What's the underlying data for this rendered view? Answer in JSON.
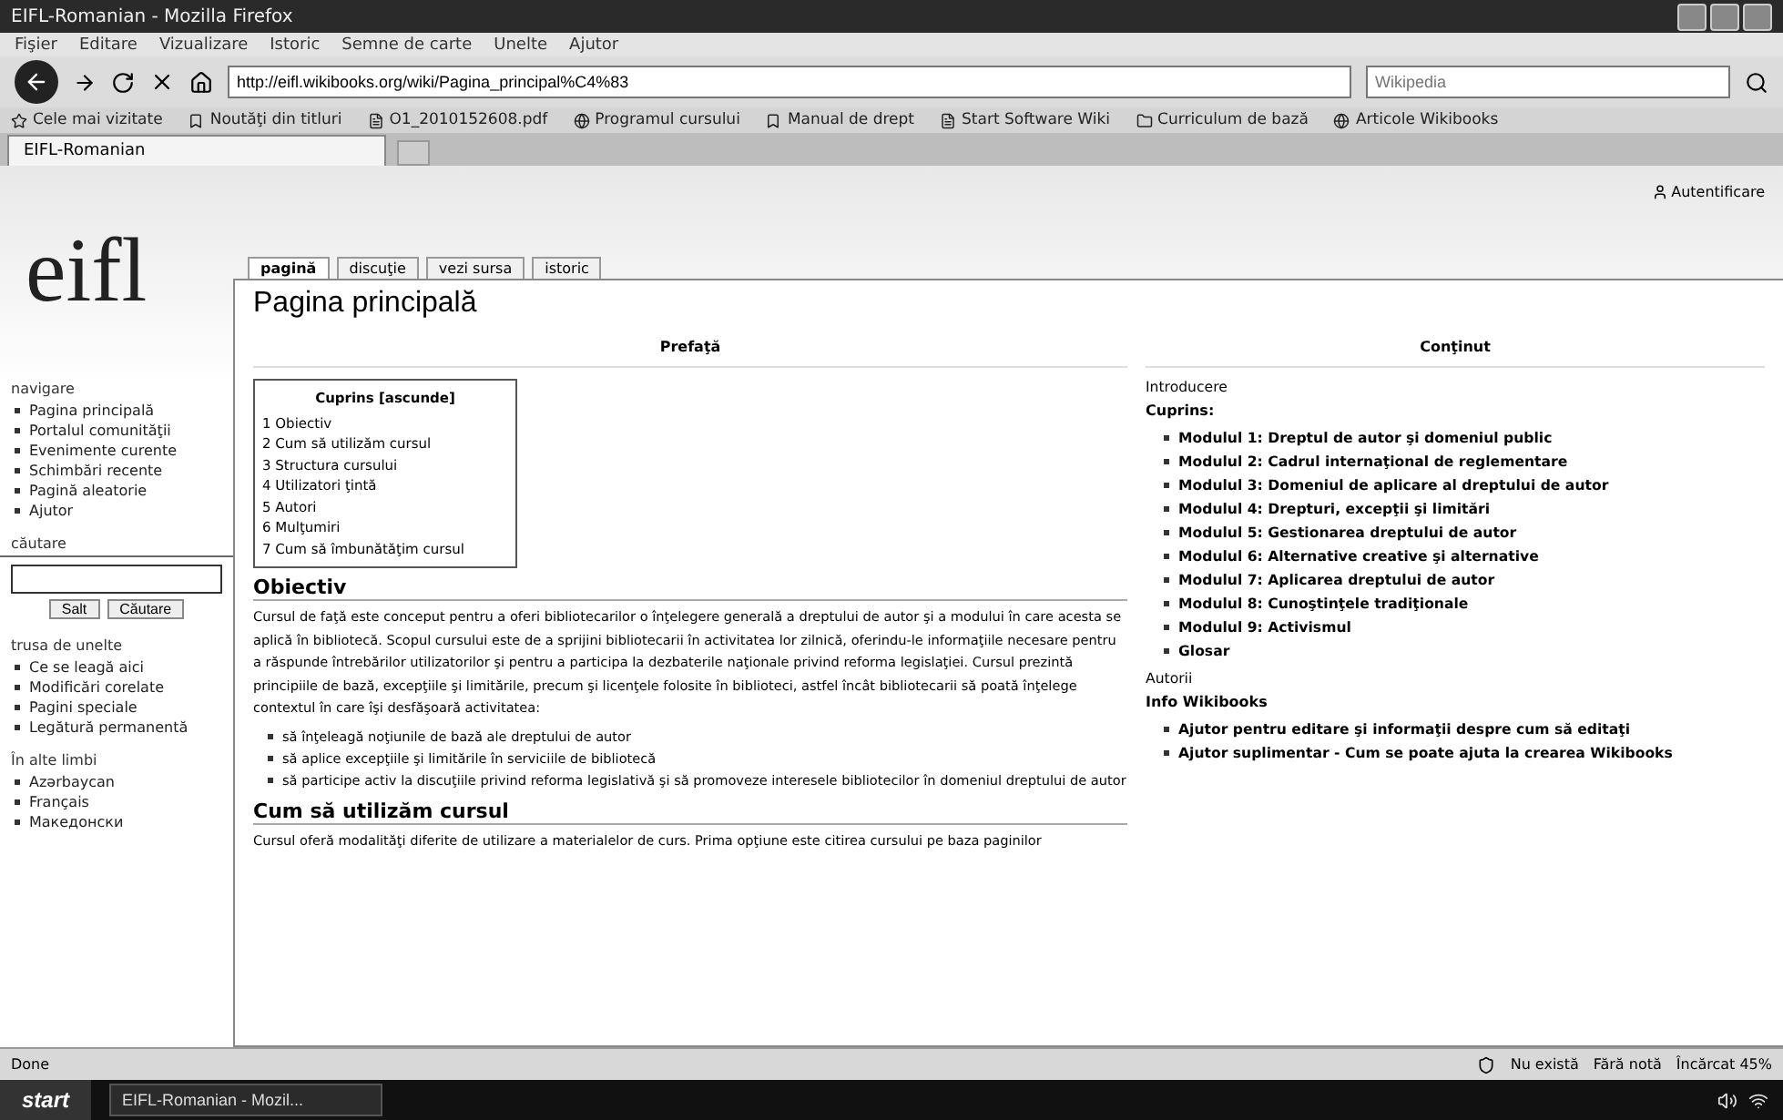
{
  "window": {
    "title": "EIFL-Romanian - Mozilla Firefox"
  },
  "menu": [
    "Fişier",
    "Editare",
    "Vizualizare",
    "Istoric",
    "Semne de carte",
    "Unelte",
    "Ajutor"
  ],
  "address": {
    "value": "http://eifl.wikibooks.org/wiki/Pagina_principal%C4%83"
  },
  "search": {
    "placeholder": "Wikipedia"
  },
  "bookmarks": [
    "Cele mai vizitate",
    "Noutăţi din titluri",
    "O1_2010152608.pdf",
    "Programul cursului",
    "Manual de drept",
    "Start Software Wiki",
    "Curriculum de bază",
    "Articole Wikibooks"
  ],
  "browser_tabs": [
    {
      "label": "EIFL-Romanian",
      "selected": true
    }
  ],
  "login": "Autentificare",
  "sidebar": {
    "logo": "eifl",
    "sections": [
      {
        "title": "navigare",
        "items": [
          "Pagina principală",
          "Portalul comunităţii",
          "Evenimente curente",
          "Schimbări recente",
          "Pagină aleatorie",
          "Ajutor"
        ]
      },
      {
        "title": "trusa de unelte",
        "items": [
          "Ce se leagă aici",
          "Modificări corelate",
          "Pagini speciale",
          "Legătură permanentă"
        ]
      },
      {
        "title": "În alte limbi",
        "items": [
          "Azərbaycan",
          "Français",
          "Македонски"
        ]
      }
    ],
    "search": {
      "title": "căutare",
      "buttons": [
        "Salt",
        "Căutare"
      ]
    }
  },
  "page_tabs": [
    {
      "label": "pagină",
      "selected": true
    },
    {
      "label": "discuţie",
      "selected": false
    },
    {
      "label": "vezi sursa",
      "selected": false
    },
    {
      "label": "istoric",
      "selected": false
    }
  ],
  "page_title": "Pagina principală",
  "preface": {
    "heading": "Prefaţă",
    "toc": {
      "title": "Cuprins [ascunde]",
      "items": [
        "1 Obiectiv",
        "2 Cum să utilizăm cursul",
        "3 Structura cursului",
        "4 Utilizatori ţintă",
        "5 Autori",
        "6 Mulţumiri",
        "7 Cum să îmbunătăţim cursul"
      ]
    },
    "sections": [
      {
        "heading": "Obiectiv",
        "text": "Cursul de faţă este conceput pentru a oferi bibliotecarilor o înţelegere generală a dreptului de autor şi a modului în care acesta se aplică în bibliotecă. Scopul cursului este de a sprijini bibliotecarii în activitatea lor zilnică, oferindu-le informaţiile necesare pentru a răspunde întrebărilor utilizatorilor şi pentru a participa la dezbaterile naţionale privind reforma legislaţiei. Cursul prezintă principiile de bază, excepţiile şi limitările, precum şi licenţele folosite în biblioteci, astfel încât bibliotecarii să poată înţelege contextul în care îşi desfăşoară activitatea:",
        "bullets": [
          "să înţeleagă noţiunile de bază ale dreptului de autor",
          "să aplice excepţiile şi limitările în serviciile de bibliotecă",
          "să participe activ la discuţiile privind reforma legislativă şi să promoveze interesele bibliotecilor în domeniul dreptului de autor"
        ]
      },
      {
        "heading": "Cum să utilizăm cursul",
        "text": "Cursul oferă modalităţi diferite de utilizare a materialelor de curs. Prima opţiune este citirea cursului pe baza paginilor"
      }
    ]
  },
  "contents": {
    "heading": "Conţinut",
    "blocks": [
      {
        "kind": "text",
        "text": "Introducere"
      },
      {
        "kind": "heading",
        "text": "Cuprins:"
      },
      {
        "kind": "list",
        "items": [
          "Modulul 1: Dreptul de autor şi domeniul public",
          "Modulul 2: Cadrul internaţional de reglementare",
          "Modulul 3: Domeniul de aplicare al dreptului de autor",
          "Modulul 4: Drepturi, excepţii şi limitări",
          "Modulul 5: Gestionarea dreptului de autor",
          "Modulul 6: Alternative creative şi alternative",
          "Modulul 7: Aplicarea dreptului de autor",
          "Modulul 8: Cunoştinţele tradiţionale",
          "Modulul 9: Activismul",
          "Glosar"
        ]
      },
      {
        "kind": "text",
        "text": "Autorii"
      },
      {
        "kind": "heading",
        "text": "Info Wikibooks"
      },
      {
        "kind": "list",
        "items": [
          "Ajutor pentru editare şi informaţii despre cum să editaţi",
          "Ajutor suplimentar - Cum se poate ajuta la crearea Wikibooks"
        ]
      }
    ]
  },
  "status_bar": {
    "text": "Done",
    "items": [
      "Nu există",
      "Fără notă",
      "Încărcat 45%"
    ]
  },
  "taskbar": {
    "start": "start",
    "tasks": [
      "EIFL-Romanian - Mozil..."
    ]
  }
}
